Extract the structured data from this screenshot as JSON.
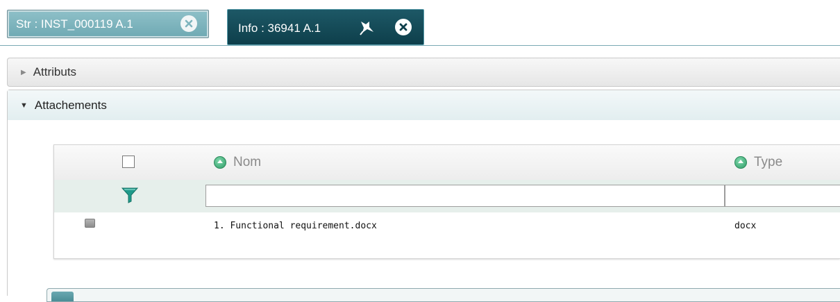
{
  "tabs": [
    {
      "label": "Str : INST_000119 A.1",
      "active": false,
      "icons": [
        "close-icon"
      ]
    },
    {
      "label": "Info : 36941 A.1",
      "active": true,
      "icons": [
        "pin-icon",
        "close-icon"
      ]
    }
  ],
  "panels": {
    "attributs": {
      "title": "Attributs",
      "expanded": false
    },
    "attachements": {
      "title": "Attachements",
      "expanded": true
    }
  },
  "grid": {
    "columns": [
      {
        "key": "nom",
        "label": "Nom"
      },
      {
        "key": "type",
        "label": "Type"
      }
    ],
    "filters": {
      "nom": "",
      "type": ""
    },
    "rows": [
      {
        "nom": "1. Functional requirement.docx",
        "type": "docx"
      }
    ]
  },
  "colors": {
    "active_tab": "#0e3f4b",
    "inactive_tab": "#7fb5be",
    "sort_icon": "#2f9c67",
    "filter_icon": "#1f9a8a"
  }
}
